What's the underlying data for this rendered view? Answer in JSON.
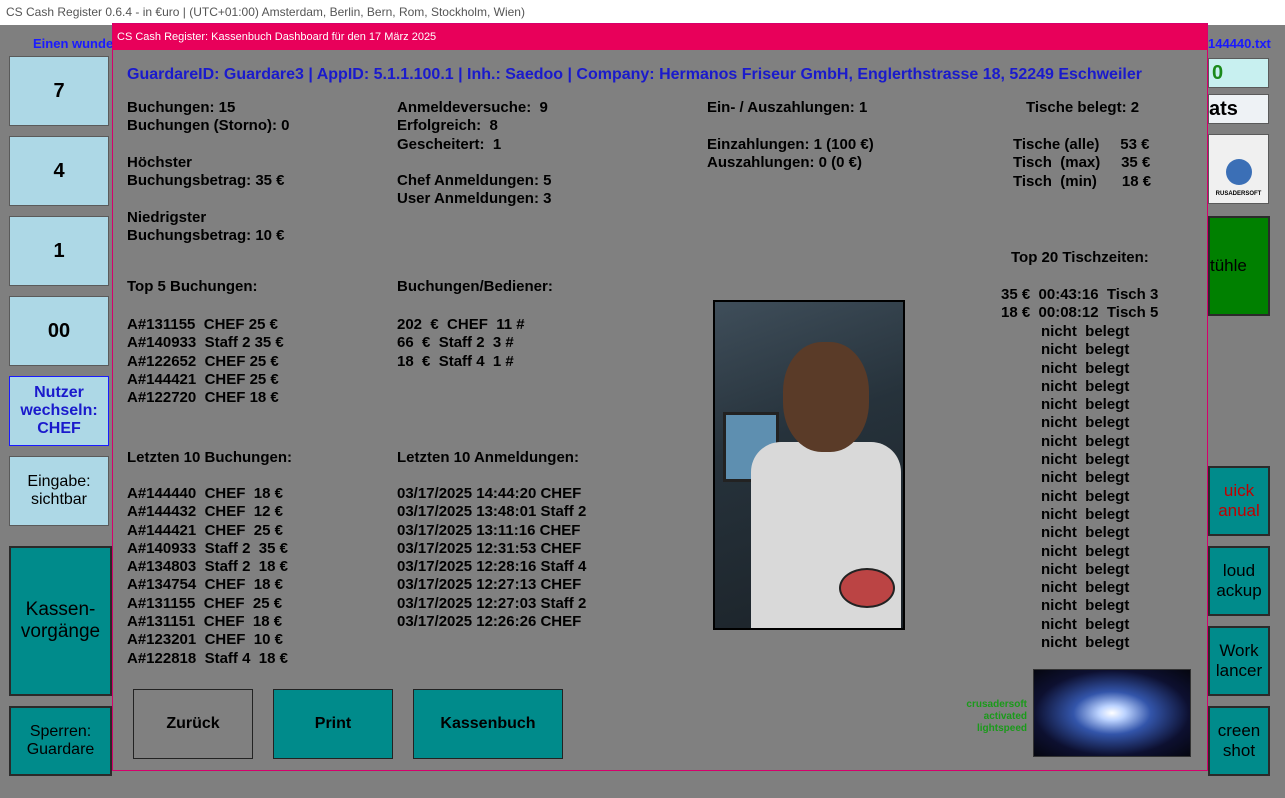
{
  "window": {
    "title": "CS Cash Register 0.6.4 - in €uro  |  (UTC+01:00) Amsterdam, Berlin, Bern, Rom, Stockholm, Wien)"
  },
  "background": {
    "marquee_left": "Einen wunde",
    "marquee_right": "144440.txt",
    "keys": [
      "7",
      "4",
      "1",
      "00"
    ],
    "user_switch_label": "Nutzer wechseln: CHEF",
    "input_label": "Eingabe: sichtbar",
    "kassen_label": "Kassen-vorgänge",
    "sperren_label": "Sperren: Guardare",
    "right_value": "0",
    "right_stats": "ats",
    "right_logo_text": "RUSADERSOFT",
    "right_stuehle": "tühle",
    "right_quick": "uick anual",
    "right_cloud": "loud ackup",
    "right_work": "Work lancer",
    "right_screen": "creen shot"
  },
  "dialog": {
    "title": "CS Cash Register: Kassenbuch Dashboard für den 17 März 2025",
    "info_line": "GuardareID: Guardare3 | AppID: 5.1.1.100.1 | Inh.: Saedoo | Company: Hermanos Friseur GmbH, Englerthstrasse 18, 52249 Eschweiler",
    "stats_col1": "Buchungen: 15\nBuchungen (Storno): 0\n\nHöchster\nBuchungsbetrag: 35 €\n\nNiedrigster\nBuchungsbetrag: 10 €",
    "stats_col2": "Anmeldeversuche:  9\nErfolgreich:  8\nGescheitert:  1\n\nChef Anmeldungen: 5\nUser Anmeldungen: 3",
    "stats_col3": "Ein- / Auszahlungen: 1\n\nEinzahlungen: 1 (100 €)\nAuszahlungen: 0 (0 €)",
    "tische_belegt": "Tische belegt: 2",
    "tische_stats": "Tische (alle)     53 €\nTisch  (max)     35 €\nTisch  (min)      18 €",
    "top5_heading": "Top 5 Buchungen:",
    "top5_list": "A#131155  CHEF 25 €\nA#140933  Staff 2 35 €\nA#122652  CHEF 25 €\nA#144421  CHEF 25 €\nA#122720  CHEF 18 €",
    "bediener_heading": "Buchungen/Bediener:",
    "bediener_list": "202  €  CHEF  11 #\n66  €  Staff 2  3 #\n18  €  Staff 4  1 #",
    "last10_heading": "Letzten 10 Buchungen:",
    "last10_list": "A#144440  CHEF  18 €\nA#144432  CHEF  12 €\nA#144421  CHEF  25 €\nA#140933  Staff 2  35 €\nA#134803  Staff 2  18 €\nA#134754  CHEF  18 €\nA#131155  CHEF  25 €\nA#131151  CHEF  18 €\nA#123201  CHEF  10 €\nA#122818  Staff 4  18 €",
    "logins_heading": "Letzten 10 Anmeldungen:",
    "logins_list": "03/17/2025 14:44:20 CHEF\n03/17/2025 13:48:01 Staff 2\n03/17/2025 13:11:16 CHEF\n03/17/2025 12:31:53 CHEF\n03/17/2025 12:28:16 Staff 4\n03/17/2025 12:27:13 CHEF\n03/17/2025 12:27:03 Staff 2\n03/17/2025 12:26:26 CHEF",
    "tischzeiten_heading": "Top 20 Tischzeiten:",
    "tischzeiten_top": "35 €  00:43:16  Tisch 3\n18 €  00:08:12  Tisch 5",
    "tischzeiten_rest": "nicht  belegt\nnicht  belegt\nnicht  belegt\nnicht  belegt\nnicht  belegt\nnicht  belegt\nnicht  belegt\nnicht  belegt\nnicht  belegt\nnicht  belegt\nnicht  belegt\nnicht  belegt\nnicht  belegt\nnicht  belegt\nnicht  belegt\nnicht  belegt\nnicht  belegt\nnicht  belegt",
    "lightspeed_label": "crusadersoft\nactivated\nlightspeed",
    "buttons": {
      "back": "Zurück",
      "print": "Print",
      "kassenbuch": "Kassenbuch"
    }
  }
}
